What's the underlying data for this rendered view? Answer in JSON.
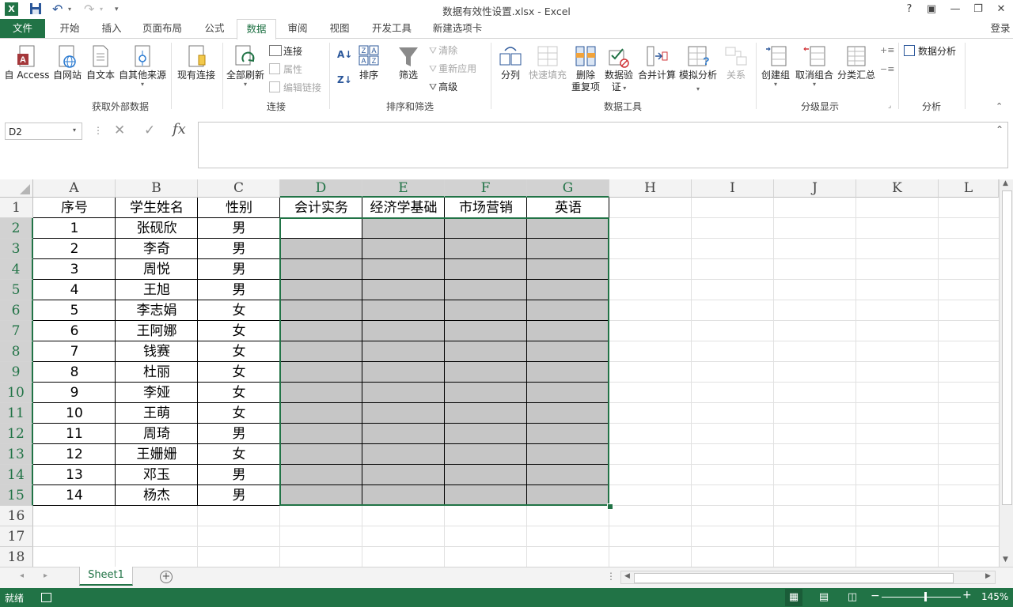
{
  "window": {
    "title": "数据有效性设置.xlsx - Excel",
    "login": "登录",
    "buttons": {
      "help": "?",
      "restore_ribbon": "▣",
      "minimize": "—",
      "maximize": "❐",
      "close": "✕"
    }
  },
  "qat": {
    "undo": "↶",
    "redo": "↷",
    "customize": "▾"
  },
  "tabs": [
    "文件",
    "开始",
    "插入",
    "页面布局",
    "公式",
    "数据",
    "审阅",
    "视图",
    "开发工具",
    "新建选项卡"
  ],
  "active_tab": "数据",
  "ribbon": {
    "get_external": {
      "access": "自 Access",
      "web": "自网站",
      "text": "自文本",
      "other": "自其他来源",
      "existing": "现有连接",
      "label": "获取外部数据"
    },
    "connections": {
      "refresh_all": "全部刷新",
      "connections": "连接",
      "properties": "属性",
      "edit_links": "编辑链接",
      "label": "连接"
    },
    "sort_filter": {
      "sort": "排序",
      "filter": "筛选",
      "clear": "清除",
      "reapply": "重新应用",
      "advanced": "高级",
      "label": "排序和筛选"
    },
    "data_tools": {
      "text_to_columns": "分列",
      "flash_fill": "快速填充",
      "remove_dup_1": "删除",
      "remove_dup_2": "重复项",
      "validation_1": "数据验",
      "validation_2": "证",
      "consolidate": "合并计算",
      "what_if": "模拟分析",
      "relationships": "关系",
      "label": "数据工具"
    },
    "outline": {
      "group": "创建组",
      "ungroup": "取消组合",
      "subtotal": "分类汇总",
      "label": "分级显示"
    },
    "analysis": {
      "data_analysis": "数据分析",
      "label": "分析"
    }
  },
  "formula_bar": {
    "name_box": "D2",
    "cancel": "✕",
    "enter": "✓",
    "fx": "fx",
    "content": ""
  },
  "columns": [
    "A",
    "B",
    "C",
    "D",
    "E",
    "F",
    "G",
    "H",
    "I",
    "J",
    "K",
    "L"
  ],
  "selected_columns": [
    "D",
    "E",
    "F",
    "G"
  ],
  "rows": [
    "1",
    "2",
    "3",
    "4",
    "5",
    "6",
    "7",
    "8",
    "9",
    "10",
    "11",
    "12",
    "13",
    "14",
    "15",
    "16",
    "17",
    "18"
  ],
  "table": {
    "headers": [
      "序号",
      "学生姓名",
      "性别",
      "会计实务",
      "经济学基础",
      "市场营销",
      "英语"
    ],
    "records": [
      [
        "1",
        "张砚欣",
        "男"
      ],
      [
        "2",
        "李奇",
        "男"
      ],
      [
        "3",
        "周悦",
        "男"
      ],
      [
        "4",
        "王旭",
        "男"
      ],
      [
        "5",
        "李志娟",
        "女"
      ],
      [
        "6",
        "王阿娜",
        "女"
      ],
      [
        "7",
        "钱赛",
        "女"
      ],
      [
        "8",
        "杜丽",
        "女"
      ],
      [
        "9",
        "李娅",
        "女"
      ],
      [
        "10",
        "王萌",
        "女"
      ],
      [
        "11",
        "周琦",
        "男"
      ],
      [
        "12",
        "王姗姗",
        "女"
      ],
      [
        "13",
        "邓玉",
        "男"
      ],
      [
        "14",
        "杨杰",
        "男"
      ]
    ]
  },
  "sheet_tabs": [
    "Sheet1"
  ],
  "status": {
    "ready": "就绪",
    "zoom": "145%",
    "zoom_minus": "−",
    "zoom_plus": "+"
  },
  "colors": {
    "accent": "#217346",
    "selection_fill": "#c6c6c6"
  }
}
